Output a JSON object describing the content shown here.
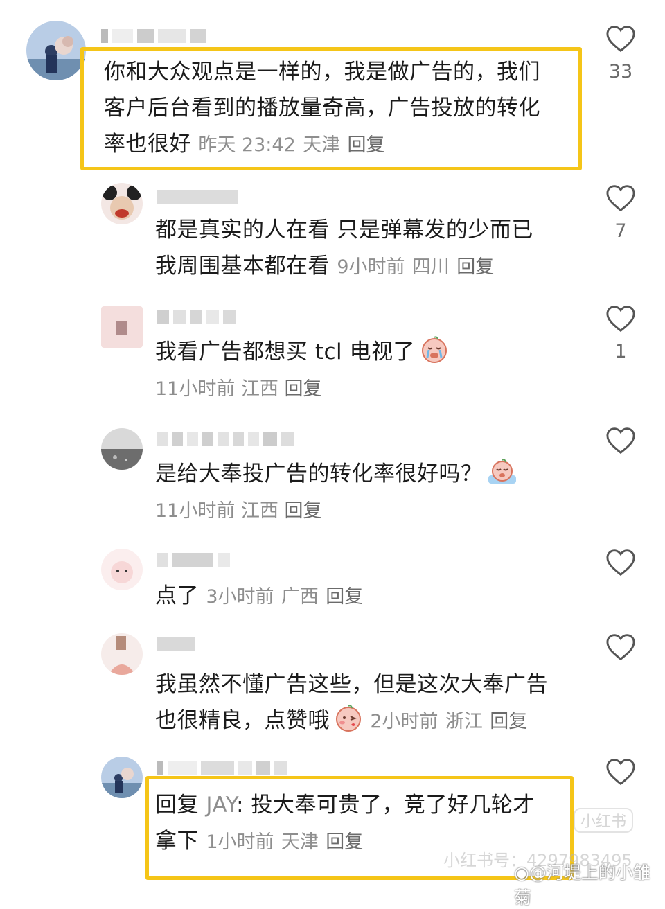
{
  "comments": [
    {
      "text": "你和大众观点是一样的，我是做广告的，我们客户后台看到的播放量奇高，广告投放的转化率也很好",
      "line1": "你和大众观点是一样的，我是做广告的，我们",
      "line2": "客户后台看到的播放量奇高，广告投放的转化",
      "line3": "率也很好",
      "time": "昨天 23:42",
      "location": "天津",
      "reply_label": "回复",
      "likes": "33"
    },
    {
      "line1": "都是真实的人在看 只是弹幕发的少而已",
      "line2": "我周围基本都在看",
      "time": "9小时前",
      "location": "四川",
      "reply_label": "回复",
      "likes": "7"
    },
    {
      "line1": "我看广告都想买 tcl 电视了",
      "emoji": "crying-face-emoji",
      "time": "11小时前",
      "location": "江西",
      "reply_label": "回复",
      "likes": "1"
    },
    {
      "line1": "是给大奉投广告的转化率很好吗？",
      "emoji": "crying-face-emoji",
      "time": "11小时前",
      "location": "江西",
      "reply_label": "回复",
      "likes": ""
    },
    {
      "line1": "点了",
      "time": "3小时前",
      "location": "广西",
      "reply_label": "回复",
      "likes": ""
    },
    {
      "line1": "我虽然不懂广告这些，但是这次大奉广告",
      "line2": "也很精良，点赞哦",
      "emoji": "blushing-face-emoji",
      "time": "2小时前",
      "location": "浙江",
      "reply_label": "回复",
      "likes": ""
    },
    {
      "reply_prefix": "回复",
      "reply_to": "JAY",
      "line1_rest": ": 投大奉可贵了，竞了好几轮才",
      "line2": "拿下",
      "time": "1小时前",
      "location": "天津",
      "reply_label": "回复",
      "likes": ""
    }
  ],
  "watermarks": {
    "platform": "小红书",
    "id_text": "小红书号：4297983495",
    "weibo": "@河堤上的小雏菊"
  },
  "colors": {
    "highlight": "#f5c518",
    "meta": "#8e8e8e",
    "text": "#1b1b1b"
  }
}
